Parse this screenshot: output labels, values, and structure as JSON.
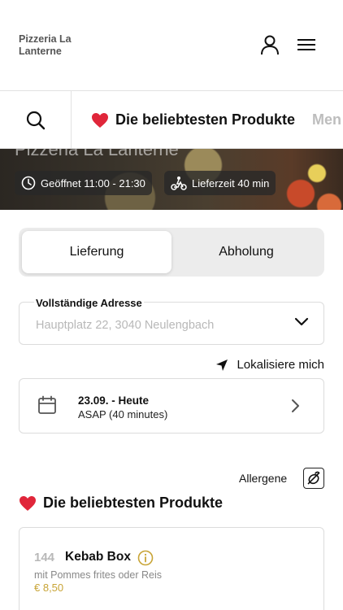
{
  "header": {
    "logo_text": "Pizzeria La Lanterne",
    "icons": {
      "account": "user-icon",
      "menu": "hamburger-menu-icon"
    }
  },
  "category_bar": {
    "search_icon": "search-icon",
    "active": "Die beliebtesten Produkte",
    "next": "Men"
  },
  "hero": {
    "title": "Pizzeria La Lanterne",
    "opening": "Geöffnet 11:00 - 21:30",
    "delivery_time": "Lieferzeit 40 min"
  },
  "order_type": {
    "options": [
      "Lieferung",
      "Abholung"
    ],
    "selected": "Lieferung"
  },
  "address": {
    "label": "Vollständige Adresse",
    "value": "Hauptplatz 22, 3040 Neulengbach"
  },
  "locate": {
    "label": "Lokalisiere mich"
  },
  "delivery_date": {
    "date": "23.09. - Heute",
    "time": "ASAP (40 minutes)"
  },
  "allergens": {
    "label": "Allergene"
  },
  "section": {
    "title": "Die beliebtesten Produkte"
  },
  "products": [
    {
      "number": "144",
      "name": "Kebab Box",
      "description": "mit Pommes frites oder Reis",
      "price": "€ 8,50"
    }
  ],
  "colors": {
    "accent_gold": "#c8a436",
    "heart": "#e0263a",
    "border": "#dcdcdc",
    "muted": "#b8b8b8"
  }
}
